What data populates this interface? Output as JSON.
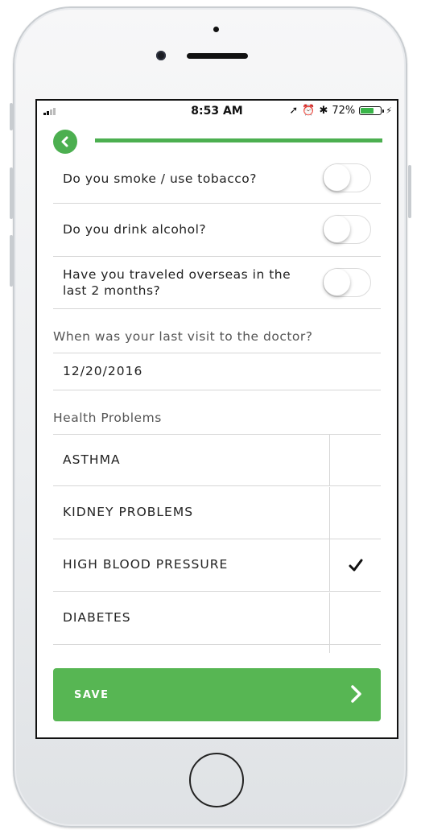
{
  "status_bar": {
    "time": "8:53 AM",
    "battery": "72%",
    "battery_level": 0.72
  },
  "questions": [
    {
      "label": "Do you smoke / use tobacco?",
      "on": false
    },
    {
      "label": "Do you drink alcohol?",
      "on": false
    },
    {
      "label_line1": "Have you traveled overseas in the",
      "label_line2": "last 2 months?",
      "on": false
    }
  ],
  "last_visit": {
    "label": "When was your last visit to the doctor?",
    "value": "12/20/2016"
  },
  "health_problems": {
    "label": "Health Problems",
    "items": [
      {
        "label": "ASTHMA",
        "checked": false
      },
      {
        "label": "KIDNEY PROBLEMS",
        "checked": false
      },
      {
        "label": "HIGH BLOOD PRESSURE",
        "checked": true
      },
      {
        "label": "DIABETES",
        "checked": false
      }
    ]
  },
  "save_button": {
    "label": "SAVE"
  },
  "colors": {
    "accent": "#4caf50",
    "save": "#57b653"
  }
}
